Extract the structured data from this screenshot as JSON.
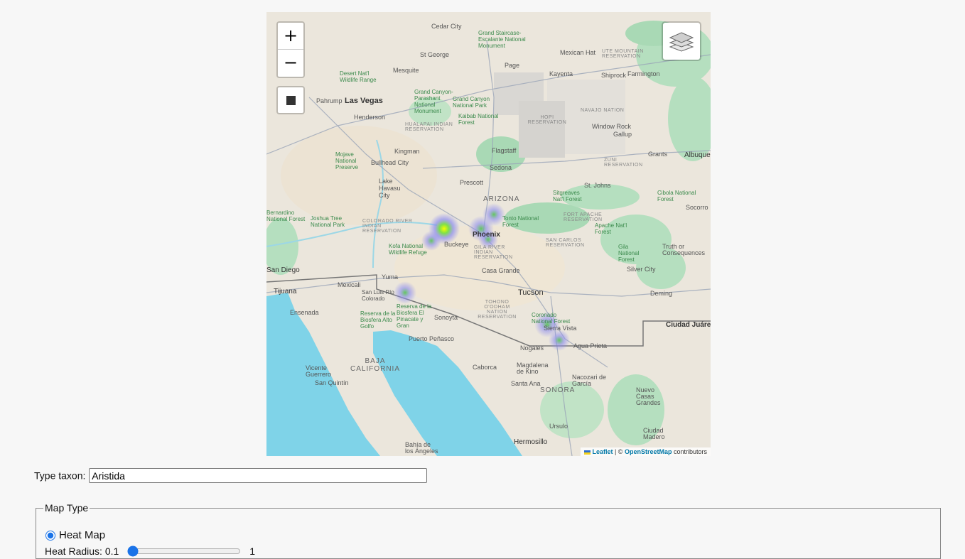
{
  "map": {
    "zoom_in": "+",
    "zoom_out": "−",
    "attribution": {
      "leaflet": "Leaflet",
      "separator": " | © ",
      "osm": "OpenStreetMap",
      "suffix": " contributors"
    },
    "labels": {
      "cedar_city": "Cedar City",
      "grand_staircase": "Grand Staircase-Escalante National Monument",
      "st_george": "St George",
      "mexican_hat": "Mexican Hat",
      "ute_mountain": "UTE MOUNTAIN RESERVATION",
      "page": "Page",
      "kayenta": "Kayenta",
      "shiprock": "Shiprock",
      "farmington": "Farmington",
      "desert_nwr": "Desert Nat'l Wildlife Range",
      "mesquite": "Mesquite",
      "las_vegas": "Las Vegas",
      "henderson": "Henderson",
      "pahrump": "Pahrump",
      "grand_canyon_parashant": "Grand Canyon-Parashant National Monument",
      "grand_canyon_np": "Grand Canyon National Park",
      "kaibab": "Kaibab National Forest",
      "hualapai": "HUALAPAI INDIAN RESERVATION",
      "hopi": "HOPI RESERVATION",
      "navajo": "NAVAJO NATION",
      "window_rock": "Window Rock",
      "gallup": "Gallup",
      "kingman": "Kingman",
      "flagstaff": "Flagstaff",
      "grants": "Grants",
      "albuquerque": "Albuque",
      "mojave": "Mojave National Preserve",
      "bullhead": "Bullhead City",
      "sedona": "Sedona",
      "zuni": "ZUNI RESERVATION",
      "lake_havasu": "Lake Havasu City",
      "prescott": "Prescott",
      "st_johns": "St. Johns",
      "arizona": "ARIZONA",
      "sitgreaves": "Sitgreaves Nat'l Forest",
      "cibola": "Cibola National Forest",
      "socorro": "Socorro",
      "bernardino": "Bernardino National Forest",
      "joshua_tree": "Joshua Tree National Park",
      "colorado_river": "COLORADO RIVER INDIAN RESERVATION",
      "tonto": "Tonto National Forest",
      "fort_apache": "FORT APACHE RESERVATION",
      "apache": "Apache Nat'l Forest",
      "phoenix": "Phoenix",
      "buckeye": "Buckeye",
      "kofa": "Kofa National Wildlife Refuge",
      "gila_river": "GILA RIVER INDIAN RESERVATION",
      "san_carlos": "SAN CARLOS RESERVATION",
      "gila_nf": "Gila National Forest",
      "truth": "Truth or Consequences",
      "san_diego": "San Diego",
      "yuma": "Yuma",
      "casa_grande": "Casa Grande",
      "silver_city": "Silver City",
      "tijuana": "Tijuana",
      "mexicali": "Mexicali",
      "san_luis": "San Luis Río Colorado",
      "tucson": "Tucson",
      "deming": "Deming",
      "ensenada": "Ensenada",
      "tohono": "TOHONO O'ODHAM NATION RESERVATION",
      "el_pinacate": "Reserva de la Biosfera El Pinacate y Gran",
      "sonoyta": "Sonoyta",
      "coronado": "Coronado National Forest",
      "sierra_vista": "Sierra Vista",
      "ciudad_juarez": "Ciudad Juárez",
      "reserva_alto": "Reserva de la Biosfera Alto Golfo",
      "puerto_penasco": "Puerto Peñasco",
      "nogales": "Nogales",
      "agua_prieta": "Agua Prieta",
      "baja": "BAJA CALIFORNIA",
      "caborca": "Caborca",
      "magdalena": "Magdalena de Kino",
      "nacozari": "Nacozari de García",
      "nuevo_casas": "Nuevo Casas Grandes",
      "vicente": "Vicente Guerrero",
      "san_quintin": "San Quintín",
      "santa_ana": "Santa Ana",
      "sonora": "SONORA",
      "hermosillo": "Hermosillo",
      "ursulo": "Ursulo",
      "bahia": "Bahía de los Ángeles",
      "ciudad_madero": "Ciudad Madero"
    }
  },
  "taxon": {
    "label": "Type taxon:",
    "value": "Aristida"
  },
  "map_type": {
    "legend": "Map Type",
    "heat_map_label": "Heat Map",
    "heat_radius_label": "Heat Radius: 0.1",
    "heat_radius_value": 0.1,
    "heat_radius_max_label": "1"
  }
}
